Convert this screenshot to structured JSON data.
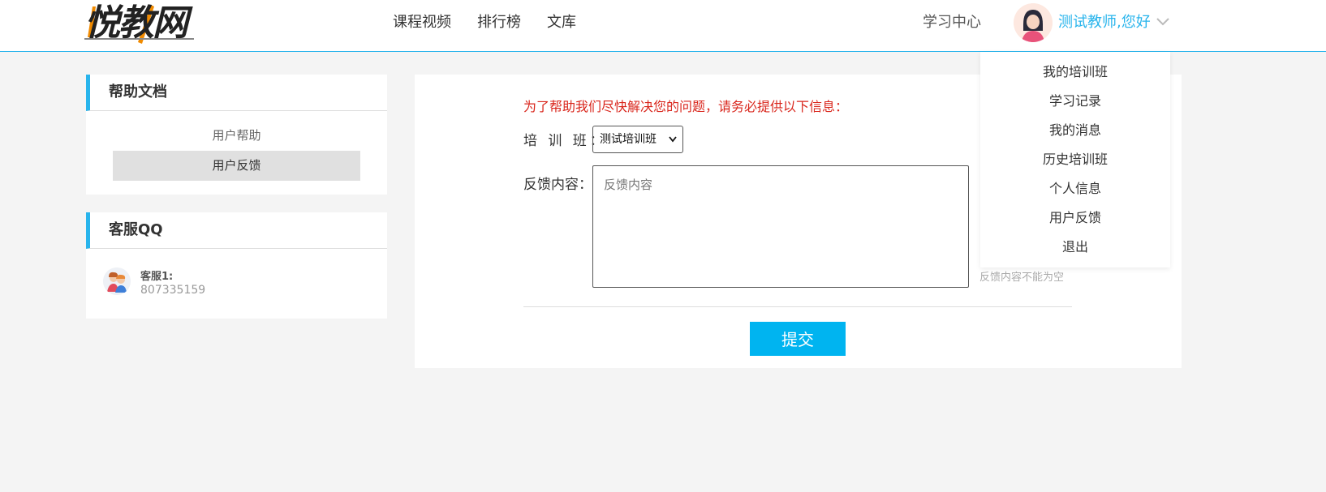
{
  "header": {
    "logo_text": "悦教网",
    "nav": [
      "课程视频",
      "排行榜",
      "文库"
    ],
    "learn_center": "学习中心",
    "greeting": "测试教师,您好",
    "accent_color": "#28b4ec"
  },
  "dropdown": {
    "items": [
      "我的培训班",
      "学习记录",
      "我的消息",
      "历史培训班",
      "个人信息",
      "用户反馈",
      "退出"
    ]
  },
  "sidebar": {
    "help": {
      "title": "帮助文档",
      "links": [
        "用户帮助",
        "用户反馈"
      ],
      "active": "用户反馈"
    },
    "qq": {
      "title": "客服QQ",
      "label": "客服1:",
      "number": "807335159"
    }
  },
  "form": {
    "notice": "为了帮助我们尽快解决您的问题，请务必提供以下信息：",
    "class_label": "培 训 班：",
    "class_value": "测试培训班",
    "content_label": "反馈内容：",
    "content_placeholder": "反馈内容",
    "error": "反馈内容不能为空",
    "submit": "提交",
    "notice_color": "#d9261c",
    "button_color": "#00b4f0"
  }
}
